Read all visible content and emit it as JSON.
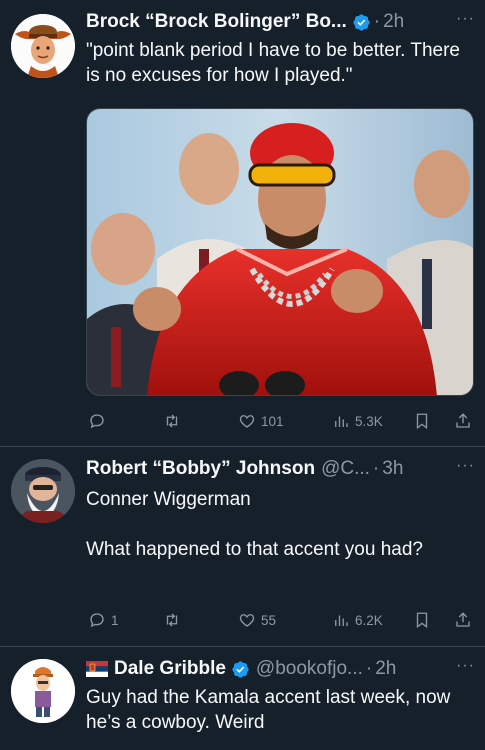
{
  "tweets": [
    {
      "name": "Brock “Brock Bolinger” Bo...",
      "handle": "",
      "time": "2h",
      "text": "\"point blank period I have to be better. There is no excuses for how I played.\"",
      "replies": "",
      "retweets": "",
      "likes": "101",
      "views": "5.3K",
      "verified": true
    },
    {
      "name": "Robert “Bobby” Johnson",
      "handle": "@C...",
      "time": "3h",
      "text": "Conner Wiggerman\n\nWhat happened to that accent you had?",
      "replies": "1",
      "retweets": "",
      "likes": "55",
      "views": "6.2K",
      "verified": false
    },
    {
      "name": "Dale Gribble",
      "handle": "@bookofjo...",
      "time": "2h",
      "text": "Guy had the Kamala accent last week, now he’s a cowboy. Weird",
      "verified": true,
      "flag": "serbia-flag"
    }
  ],
  "theme": {
    "background": "#15202b",
    "text": "#f7f9f9",
    "muted": "#8b98a5",
    "verified": "#1d9bf0",
    "divider": "#38444d"
  },
  "more_glyph": "···",
  "dot_glyph": "·"
}
